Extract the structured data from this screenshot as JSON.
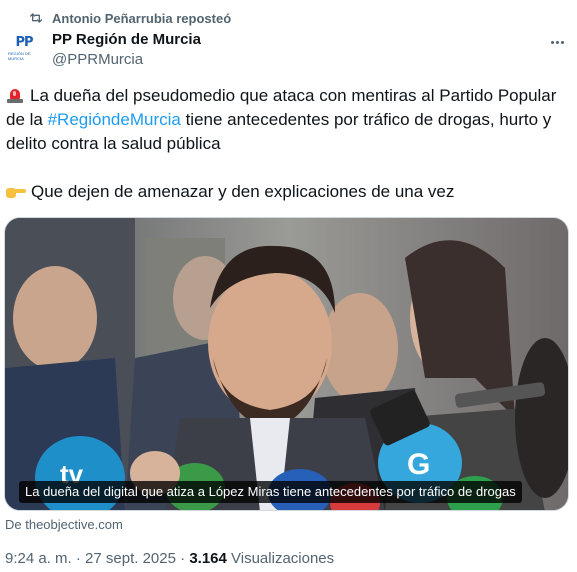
{
  "repost": {
    "icon": "repost-icon",
    "label": "Antonio Peñarrubia reposteó"
  },
  "author": {
    "avatar_text": "PP",
    "avatar_subtext": "Región de Murcia",
    "name": "PP Región de Murcia",
    "handle": "@PPRMurcia"
  },
  "tweet": {
    "line1_emoji": "siren-emoji",
    "text_part1": "La dueña del pseudomedio que ataca con mentiras al Partido Popular de la ",
    "hashtag": "#RegióndeMurcia",
    "text_part2": " tiene antecedentes por tráfico de drogas, hurto y delito contra la salud pública",
    "line2_emoji": "pointing-right-emoji",
    "text_line2": "Que dejen de amenazar y den explicaciones de una vez"
  },
  "media": {
    "caption": "La dueña del digital que atiza a López Miras tiene antecedentes por tráfico de drogas",
    "mic_label_1": "tv",
    "mic_label_2": "G"
  },
  "link_card": {
    "source": "De theobjective.com"
  },
  "meta": {
    "time": "9:24 a. m.",
    "separator": " · ",
    "date": "27 sept. 2025",
    "views_count": "3.164",
    "views_label": " Visualizaciones"
  },
  "colors": {
    "accent": "#1d9bf0",
    "secondary_text": "#536471",
    "primary_text": "#0f1419",
    "brand": "#1a5fb4"
  }
}
